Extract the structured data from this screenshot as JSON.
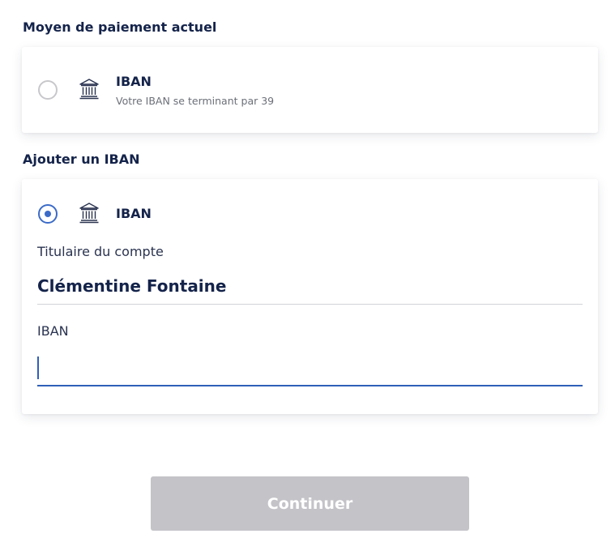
{
  "current_method": {
    "heading": "Moyen de paiement actuel",
    "option": {
      "icon": "bank-icon",
      "label": "IBAN",
      "sublabel": "Votre IBAN se terminant par 39",
      "selected": false
    }
  },
  "add_method": {
    "heading": "Ajouter un IBAN",
    "option": {
      "icon": "bank-icon",
      "label": "IBAN",
      "selected": true
    },
    "holder": {
      "label": "Titulaire du compte",
      "value": "Clémentine Fontaine"
    },
    "iban": {
      "label": "IBAN",
      "value": "",
      "placeholder": ""
    }
  },
  "actions": {
    "continue_label": "Continuer"
  },
  "colors": {
    "accent": "#3b6bc8",
    "text_dark": "#14234a",
    "button_disabled": "#c4c3c8"
  }
}
